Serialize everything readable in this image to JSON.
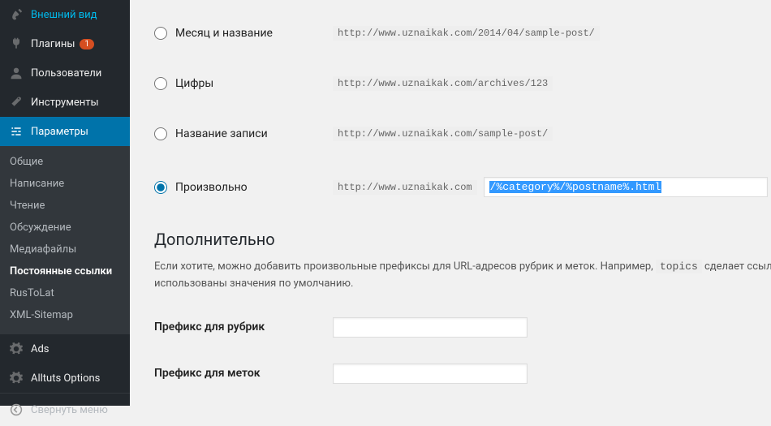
{
  "sidebar": {
    "top": [
      {
        "label": "Внешний вид"
      },
      {
        "label": "Плагины",
        "badge": "1"
      },
      {
        "label": "Пользователи"
      },
      {
        "label": "Инструменты"
      },
      {
        "label": "Параметры"
      }
    ],
    "submenu": [
      {
        "label": "Общие"
      },
      {
        "label": "Написание"
      },
      {
        "label": "Чтение"
      },
      {
        "label": "Обсуждение"
      },
      {
        "label": "Медиафайлы"
      },
      {
        "label": "Постоянные ссылки"
      },
      {
        "label": "RusToLat"
      },
      {
        "label": "XML-Sitemap"
      }
    ],
    "bottom": [
      {
        "label": "Ads"
      },
      {
        "label": "Alltuts Options"
      }
    ],
    "collapse": "Свернуть меню"
  },
  "permalinks": {
    "options": [
      {
        "label": "Месяц и название",
        "sample": "http://www.uznaikak.com/2014/04/sample-post/"
      },
      {
        "label": "Цифры",
        "sample": "http://www.uznaikak.com/archives/123"
      },
      {
        "label": "Название записи",
        "sample": "http://www.uznaikak.com/sample-post/"
      }
    ],
    "custom": {
      "label": "Произвольно",
      "prefix": "http://www.uznaikak.com",
      "value": "/%category%/%postname%.html"
    }
  },
  "optional": {
    "heading": "Дополнительно",
    "desc_1": "Если хотите, можно добавить произвольные префиксы для URL-адресов рубрик и меток. Например, ",
    "desc_code": "topics",
    "desc_2": " сделает ссыл",
    "desc_3": "использованы значения по умолчанию.",
    "category_label": "Префикс для рубрик",
    "tag_label": "Префикс для меток"
  }
}
